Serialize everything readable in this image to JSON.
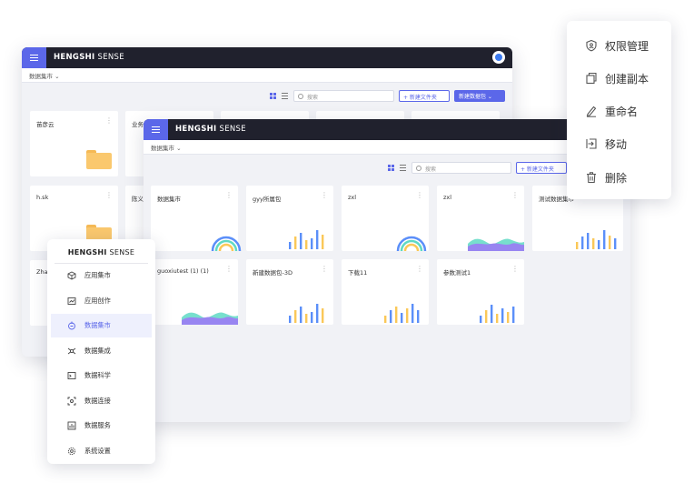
{
  "back_window": {
    "brand_bold": "HENGSHI",
    "brand_light": " SENSE",
    "breadcrumb": "数据集市",
    "search_placeholder": "搜索",
    "new_folder": "+ 新建文件夹",
    "new_dataset": "新建数据包",
    "cards": [
      {
        "title": "苗彦云"
      },
      {
        "title": "业务"
      },
      {
        "title": "h.sk"
      },
      {
        "title": "陈义"
      },
      {
        "title": "Zhan"
      }
    ]
  },
  "front_window": {
    "brand_bold": "HENGSHI",
    "brand_light": " SENSE",
    "breadcrumb": "数据集市",
    "search_placeholder": "搜索",
    "new_folder": "+ 新建文件夹",
    "cards": [
      {
        "title": "数据集市",
        "thumb": "rainbow"
      },
      {
        "title": "gyy所属包",
        "thumb": "bars"
      },
      {
        "title": "zxl",
        "thumb": "rainbow"
      },
      {
        "title": "zxl",
        "thumb": "area"
      },
      {
        "title": "测试数据集市",
        "thumb": "bars"
      },
      {
        "title": "guoxiutest (1) (1)",
        "thumb": "area"
      },
      {
        "title": "新建数据包-3D",
        "thumb": "bars"
      },
      {
        "title": "下载11",
        "thumb": "bars"
      },
      {
        "title": "参数测试1",
        "thumb": "bars"
      }
    ]
  },
  "side_menu": {
    "brand_bold": "HENGSHI",
    "brand_light": " SENSE",
    "items": [
      {
        "label": "应用集市",
        "icon": "cube-icon",
        "active": false
      },
      {
        "label": "应用创作",
        "icon": "chart-window-icon",
        "active": false
      },
      {
        "label": "数据集市",
        "icon": "data-market-icon",
        "active": true
      },
      {
        "label": "数据集成",
        "icon": "integration-icon",
        "active": false
      },
      {
        "label": "数据科学",
        "icon": "terminal-icon",
        "active": false
      },
      {
        "label": "数据连接",
        "icon": "connection-icon",
        "active": false
      },
      {
        "label": "数据服务",
        "icon": "bar-chart-icon",
        "active": false
      },
      {
        "label": "系统设置",
        "icon": "gear-icon",
        "active": false
      }
    ]
  },
  "context_menu": {
    "items": [
      {
        "label": "权限管理",
        "icon": "shield-icon"
      },
      {
        "label": "创建副本",
        "icon": "copy-icon"
      },
      {
        "label": "重命名",
        "icon": "pencil-icon"
      },
      {
        "label": "移动",
        "icon": "move-icon"
      },
      {
        "label": "删除",
        "icon": "trash-icon"
      }
    ]
  },
  "colors": {
    "accent": "#5b67e9",
    "titlebar": "#20212d",
    "canvas": "#f1f2f6",
    "bar_blue": "#5b8ff9",
    "bar_yellow": "#fac858",
    "area_purple": "#9b7bf5",
    "area_teal": "#5fd9c4",
    "folder": "#fac86e"
  }
}
